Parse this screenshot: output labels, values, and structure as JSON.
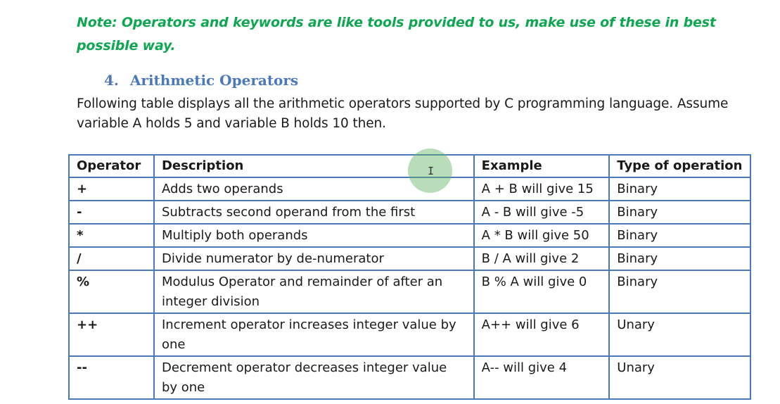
{
  "note": "Note: Operators and keywords are like tools provided to us, make use of these in best possible way.",
  "heading": {
    "number": "4.",
    "title": "Arithmetic Operators"
  },
  "intro": "Following table displays all the arithmetic operators supported by C programming language. Assume variable A holds 5 and variable B holds 10 then.",
  "table": {
    "headers": [
      "Operator",
      "Description",
      "Example",
      "Type of operation"
    ],
    "rows": [
      [
        "+",
        "Adds two operands",
        "A + B will give 15",
        "Binary"
      ],
      [
        "-",
        "Subtracts second operand from the first",
        "A - B will give -5",
        "Binary"
      ],
      [
        "*",
        "Multiply both operands",
        "A * B will give 50",
        "Binary"
      ],
      [
        "/",
        "Divide numerator by de-numerator",
        "B / A will give 2",
        "Binary"
      ],
      [
        "%",
        "Modulus Operator and remainder of after an integer division",
        "B % A will give 0",
        "Binary"
      ],
      [
        "++",
        "Increment operator increases integer value by one",
        "A++ will give 6",
        "Unary"
      ],
      [
        "--",
        "Decrement operator decreases integer value by one",
        "A-- will give 4",
        "Unary"
      ]
    ]
  },
  "cursor": {
    "icon": "text-cursor-icon",
    "glyph": "I",
    "highlight_color": "#62b462"
  },
  "colors": {
    "note": "#0ea651",
    "heading": "#4a78b8",
    "table_border": "#4a78b8"
  }
}
